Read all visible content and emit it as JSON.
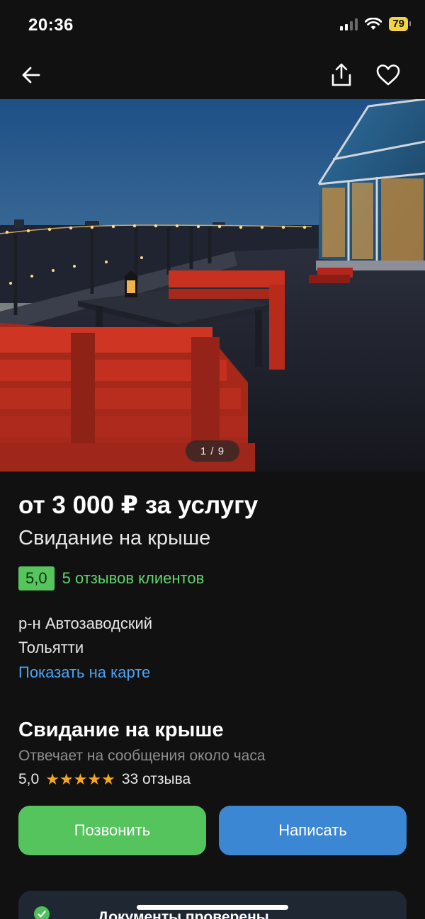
{
  "status_bar": {
    "time": "20:36",
    "battery": "79"
  },
  "hero": {
    "photo_counter": "1 / 9"
  },
  "listing": {
    "price": "от 3 000 ₽ за услугу",
    "title": "Свидание на крыше",
    "rating_value": "5,0",
    "reviews_text": "5 отзывов клиентов",
    "district": "р-н Автозаводский",
    "city": "Тольятти",
    "map_link": "Показать на карте"
  },
  "seller": {
    "name": "Свидание на крыше",
    "response_time": "Отвечает на сообщения около часа",
    "rating": "5,0",
    "stars": "★★★★★",
    "reviews_count": "33 отзыва"
  },
  "actions": {
    "call_label": "Позвонить",
    "write_label": "Написать"
  },
  "docs_card": {
    "text": "Документы проверены"
  },
  "colors": {
    "background": "#111111",
    "accent_green": "#55c45d",
    "accent_blue": "#3b87d4",
    "link_blue": "#4ea3f0",
    "star": "#f5a623"
  },
  "icons": [
    "back-arrow-icon",
    "share-icon",
    "heart-icon",
    "signal-icon",
    "wifi-icon",
    "battery-icon",
    "check-icon"
  ]
}
